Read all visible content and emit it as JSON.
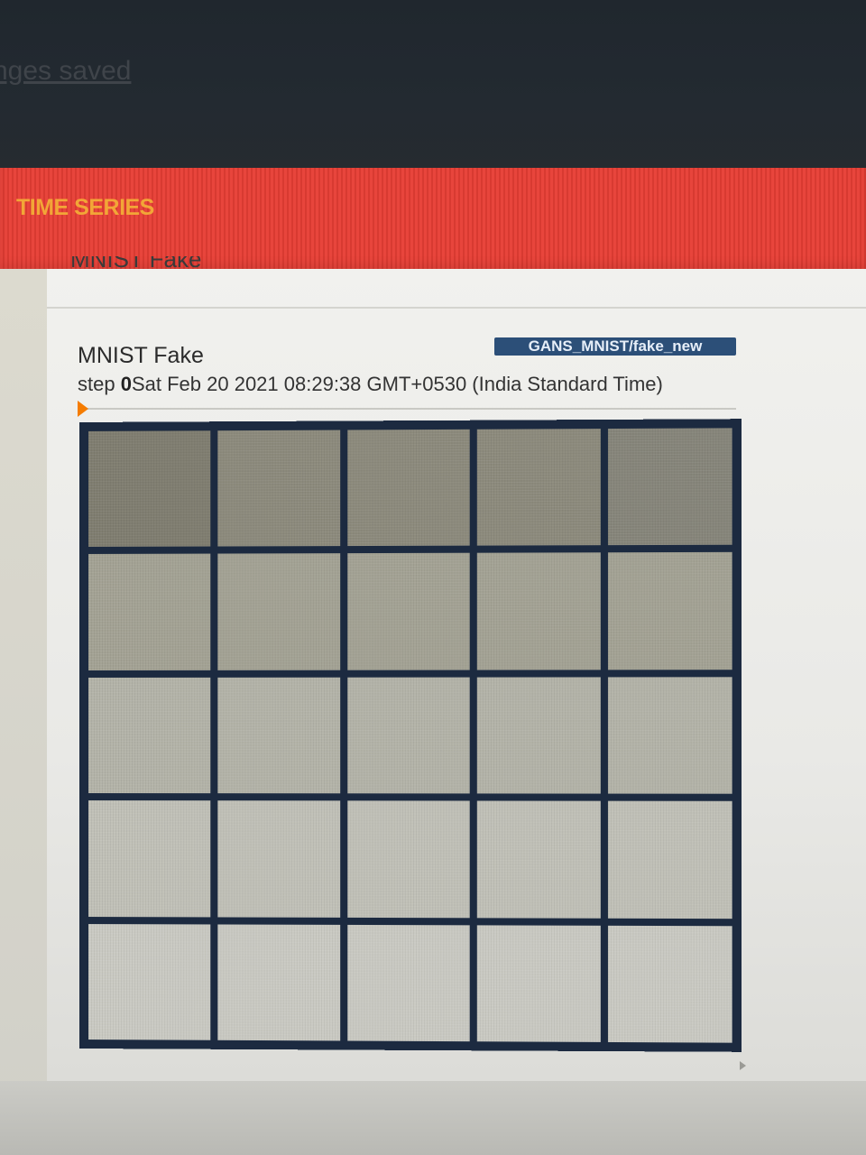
{
  "header": {
    "status_text": "nges saved"
  },
  "tabs": {
    "active_label": "TIME SERIES"
  },
  "card": {
    "top_title": "MNIST Fake",
    "image_title": "MNIST Fake",
    "run_tag": "GANS_MNIST/fake_new",
    "step_label": "step",
    "step_value": "0",
    "timestamp": "Sat Feb 20 2021 08:29:38 GMT+0530 (India Standard Time)",
    "grid": {
      "rows": 5,
      "columns": 5
    }
  },
  "colors": {
    "tab_bar": "#e8453c",
    "tab_label": "#f2a637",
    "run_badge": "#2c4f78",
    "slider_thumb": "#f57c00",
    "grid_border": "#1c2a40"
  },
  "icons": {
    "slider_thumb": "slider-thumb-icon",
    "nav_arrow": "chevron-right-icon"
  }
}
